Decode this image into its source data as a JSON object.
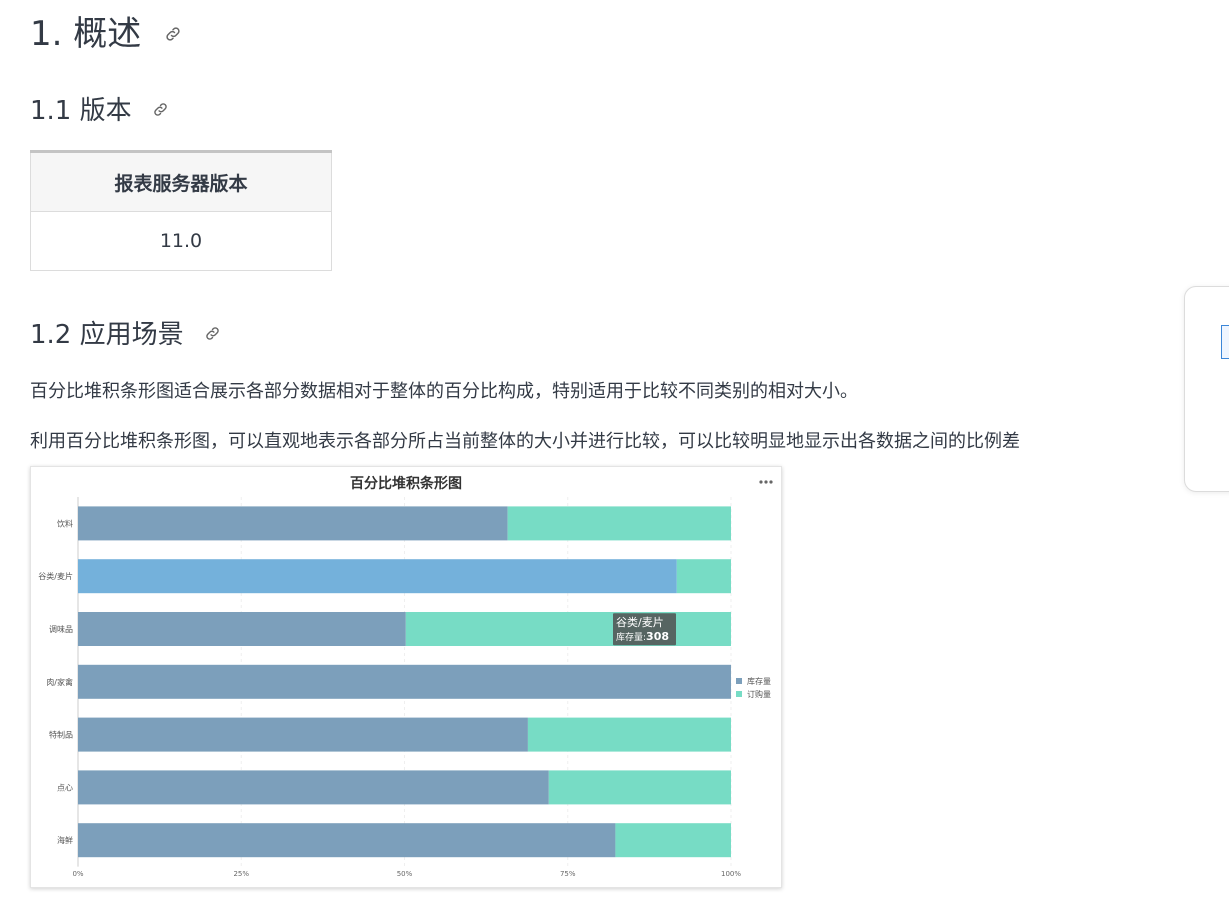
{
  "doc": {
    "h1": "1. 概述",
    "h2_version": "1.1 版本",
    "table": {
      "header": "报表服务器版本",
      "value": "11.0"
    },
    "h2_scene": "1.2 应用场景",
    "para1": "百分比堆积条形图适合展示各部分数据相对于整体的百分比构成，特别适用于比较不同类别的相对大小。",
    "para2": "利用百分比堆积条形图，可以直观地表示各部分所占当前整体的大小并进行比较，可以比较明显地显示出各数据之间的比例差",
    "more_icon": "ellipsis-icon",
    "anchor_icon": "link-icon"
  },
  "chart_data": {
    "type": "bar",
    "orientation": "horizontal",
    "stacked": "percent",
    "title": "百分比堆积条形图",
    "categories": [
      "饮料",
      "谷类/麦片",
      "调味品",
      "肉/家禽",
      "特制品",
      "点心",
      "海鲜"
    ],
    "series": [
      {
        "name": "库存量",
        "values": [
          65.8,
          91.7,
          50.2,
          100,
          68.9,
          72.1,
          82.3
        ],
        "color": "#7c9fbb"
      },
      {
        "name": "订购量",
        "values": [
          34.2,
          8.3,
          49.8,
          0,
          31.1,
          27.9,
          17.7
        ],
        "color": "#77dcc5"
      }
    ],
    "xticks": [
      "0%",
      "25%",
      "50%",
      "75%",
      "100%"
    ],
    "xlim": [
      0,
      100
    ],
    "legend": "right",
    "tooltip": {
      "category": "谷类/麦片",
      "label": "库存量:",
      "value": "308"
    }
  }
}
